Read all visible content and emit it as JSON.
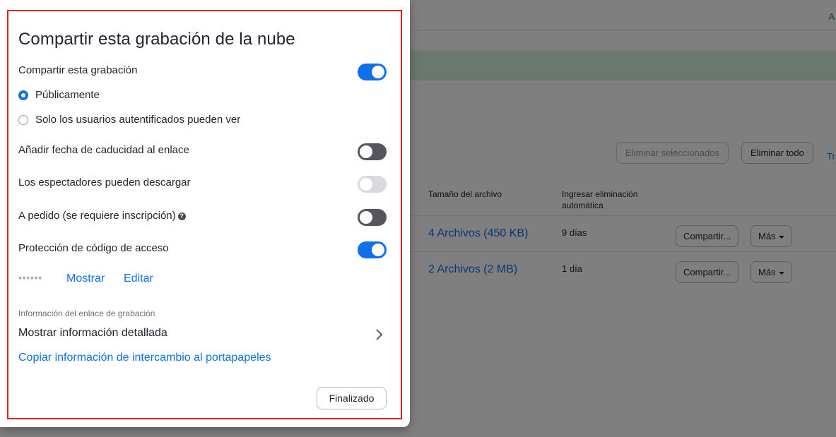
{
  "background": {
    "top_edge_link": "A",
    "buttons": {
      "delete_selected": "Eliminar seleccionados",
      "delete_all": "Eliminar todo",
      "edge_link": "Tr"
    },
    "table": {
      "headers": {
        "file_size": "Tamaño del archivo",
        "auto_delete_line1": "Ingresar eliminación",
        "auto_delete_line2": "automática"
      },
      "rows": [
        {
          "files": "4 Archivos (450 KB)",
          "auto_delete": "9 días",
          "share": "Compartir...",
          "more": "Más"
        },
        {
          "files": "2 Archivos (2 MB)",
          "auto_delete": "1 día",
          "share": "Compartir...",
          "more": "Más"
        }
      ]
    }
  },
  "dialog": {
    "title": "Compartir esta grabación de la nube",
    "share_recording": {
      "label": "Compartir esta grabación",
      "enabled": true
    },
    "visibility": {
      "public_label": "Públicamente",
      "auth_label": "Solo los usuarios autentificados pueden ver",
      "selected": "public"
    },
    "expiry": {
      "label": "Añadir fecha de caducidad al enlace",
      "enabled": false
    },
    "download": {
      "label": "Los espectadores pueden descargar",
      "enabled": false,
      "disabled": true
    },
    "on_demand": {
      "label": "A pedido (se requiere inscripción)",
      "help_glyph": "?",
      "enabled": false
    },
    "passcode": {
      "label": "Protección de código de acceso",
      "enabled": true,
      "masked_value": "******",
      "show_label": "Mostrar",
      "edit_label": "Editar"
    },
    "link_info": {
      "caption": "Información del enlace de grabación",
      "detail_label": "Mostrar información detallada",
      "copy_label": "Copiar información de intercambio al portapapeles"
    },
    "done_label": "Finalizado"
  },
  "colors": {
    "accent": "#0e71eb",
    "toggle_off": "#55555d",
    "toggle_disabled": "#dadade",
    "highlight": "#e02020",
    "banner": "#d6f1dd"
  }
}
